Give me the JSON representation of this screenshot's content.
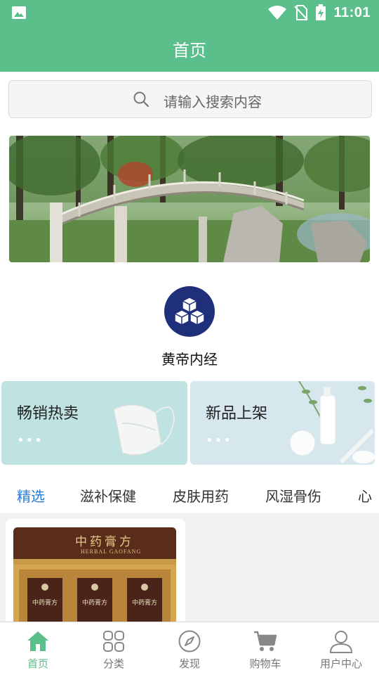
{
  "status_bar": {
    "time": "11:01",
    "icons": [
      "image-icon",
      "wifi-icon",
      "no-sim-icon",
      "battery-charging-icon"
    ]
  },
  "header": {
    "title": "首页"
  },
  "search": {
    "placeholder": "请输入搜索内容",
    "icon": "search-icon"
  },
  "categories": [
    {
      "label": "黄帝内经",
      "icon": "cubes-icon"
    }
  ],
  "promos": [
    {
      "title": "畅销热卖",
      "dots": "•••"
    },
    {
      "title": "新品上架",
      "dots": "•••"
    }
  ],
  "tabs": [
    {
      "label": "精选",
      "active": true
    },
    {
      "label": "滋补保健"
    },
    {
      "label": "皮肤用药"
    },
    {
      "label": "风湿骨伤"
    },
    {
      "label": "心"
    }
  ],
  "products": [
    {
      "image_text_cn": "中药膏方",
      "image_text_en": "HERBAL GAOFANG",
      "box_label": "中药膏方"
    }
  ],
  "bottom_nav": [
    {
      "label": "首页",
      "icon": "home-icon",
      "active": true
    },
    {
      "label": "分类",
      "icon": "grid-icon"
    },
    {
      "label": "发现",
      "icon": "compass-icon"
    },
    {
      "label": "购物车",
      "icon": "cart-icon"
    },
    {
      "label": "用户中心",
      "icon": "user-icon"
    }
  ],
  "colors": {
    "primary": "#5bbf8c",
    "tab_active": "#2a7bd6",
    "category_icon_bg": "#1f2f7a"
  }
}
